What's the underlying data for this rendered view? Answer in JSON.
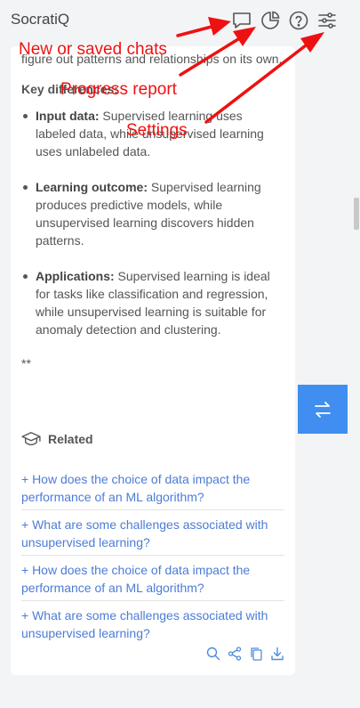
{
  "app": {
    "title": "SocratiQ"
  },
  "content": {
    "intro": "figure out patterns and relationships on its own.",
    "key_differences_label": "Key differences:",
    "differences": [
      {
        "term": "Input data:",
        "text": " Supervised learning uses labeled data, while unsupervised learning uses unlabeled data."
      },
      {
        "term": "Learning outcome:",
        "text": " Supervised learning produces predictive models, while unsupervised learning discovers hidden patterns."
      },
      {
        "term": "Applications:",
        "text": " Supervised learning is ideal for tasks like classification and regression, while unsupervised learning is suitable for anomaly detection and clustering."
      }
    ],
    "trailing": "**"
  },
  "related": {
    "label": "Related",
    "items": [
      "+ How does the choice of data impact the performance of an ML algorithm?",
      "+ What are some challenges associated with unsupervised learning?",
      "+ How does the choice of data impact the performance of an ML algorithm?",
      "+ What are some challenges associated with unsupervised learning?"
    ]
  },
  "annotations": {
    "chats": "New or saved chats",
    "progress": "Progress report",
    "settings": "Settings"
  },
  "colors": {
    "annotation": "#ee1111",
    "link": "#4c7cd6",
    "swap_button": "#3f8ef0"
  },
  "icons": {
    "header": [
      "chat-bubble-icon",
      "pie-chart-icon",
      "help-circle-icon",
      "sliders-icon"
    ],
    "actions": [
      "search-icon",
      "share-icon",
      "copy-icon",
      "download-icon"
    ],
    "related": "graduation-cap-icon",
    "swap": "swap-arrows-icon"
  }
}
